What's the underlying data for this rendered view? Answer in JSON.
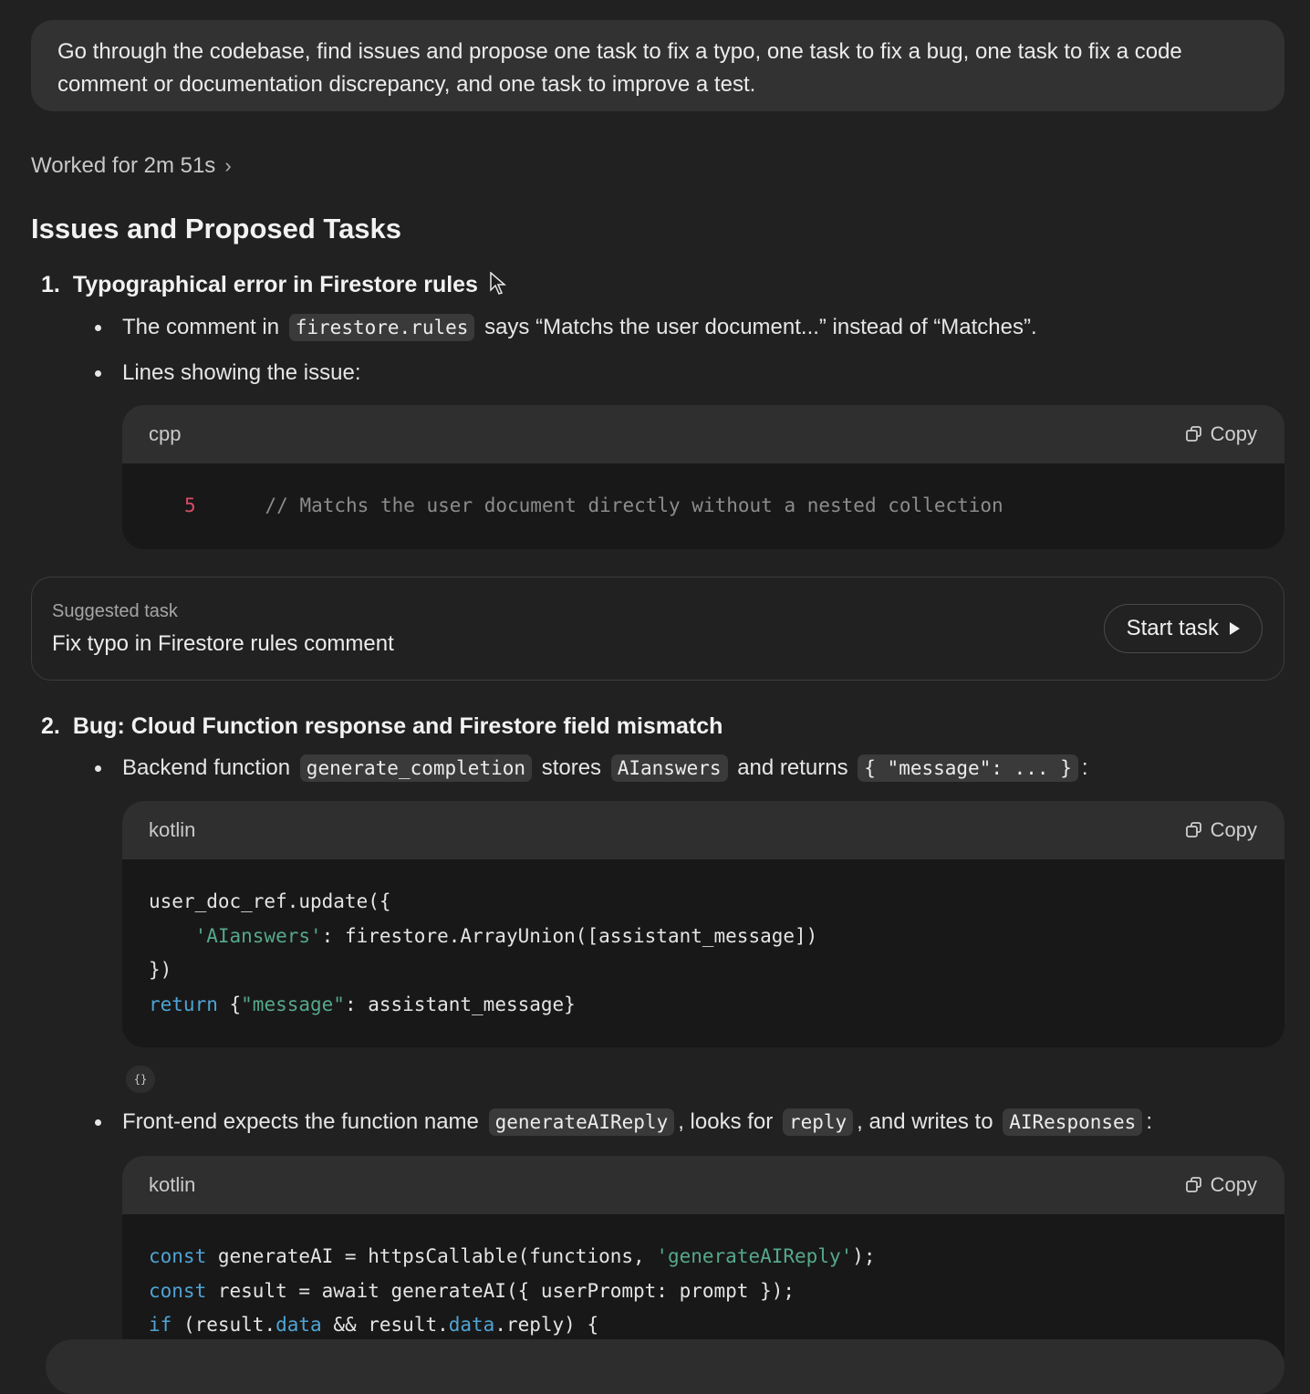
{
  "prompt": "Go through the codebase, find issues and propose one task to fix a typo, one task to fix a bug, one task to fix a code comment or documentation discrepancy, and one task to improve a test.",
  "worked_label": "Worked for 2m 51s",
  "heading": "Issues and Proposed Tasks",
  "items": [
    {
      "number": "1.",
      "title": "Typographical error in Firestore rules",
      "b1_pre": "The comment in",
      "b1_code": "firestore.rules",
      "b1_post": "says “Matchs the user document...” instead of “Matches”.",
      "b2": "Lines showing the issue:",
      "code_lang": "cpp",
      "code_line_no": "5",
      "code_line": "// Matchs the user document directly without a nested collection"
    },
    {
      "number": "2.",
      "title": "Bug: Cloud Function response and Firestore field mismatch",
      "b1_pre": "Backend function",
      "b1_code1": "generate_completion",
      "b1_mid1": "stores",
      "b1_code2": "AIanswers",
      "b1_mid2": "and returns",
      "b1_code3": "{ \"message\": ... }",
      "b1_end": ":",
      "code1_lang": "kotlin",
      "b2_pre": "Front-end expects the function name",
      "b2_code1": "generateAIReply",
      "b2_mid1": ", looks for",
      "b2_code2": "reply",
      "b2_mid2": ", and writes to",
      "b2_code3": "AIResponses",
      "b2_end": ":",
      "code2_lang": "kotlin"
    }
  ],
  "copy_label": "Copy",
  "task": {
    "label": "Suggested task",
    "title": "Fix typo in Firestore rules comment",
    "button": "Start task"
  },
  "braces_icon": "{}"
}
